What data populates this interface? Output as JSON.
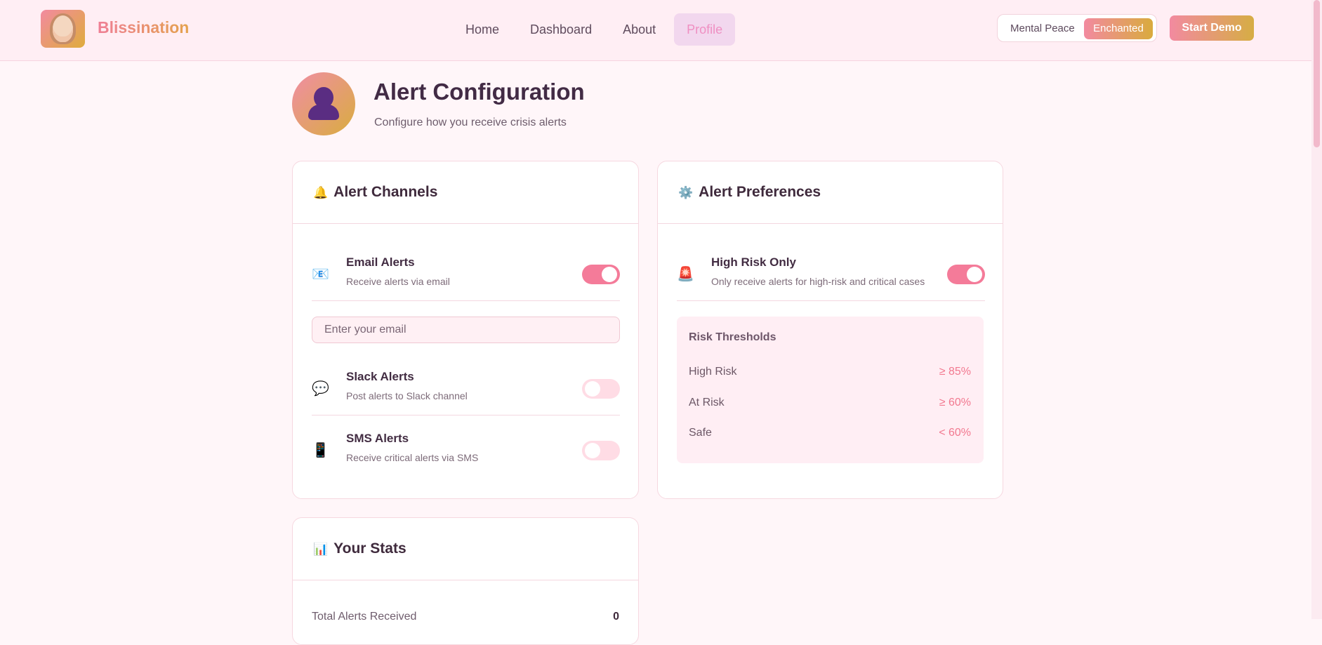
{
  "brand": {
    "name": "Blissination"
  },
  "nav": {
    "home": "Home",
    "dashboard": "Dashboard",
    "about": "About",
    "profile": "Profile"
  },
  "theme": {
    "left": "Mental Peace",
    "right": "Enchanted"
  },
  "actions": {
    "start_demo": "Start Demo"
  },
  "page": {
    "title": "Alert Configuration",
    "subtitle": "Configure how you receive crisis alerts"
  },
  "alert_channels": {
    "title": "Alert Channels",
    "email": {
      "title": "Email Alerts",
      "description": "Receive alerts via email",
      "enabled": true,
      "placeholder": "Enter your email"
    },
    "slack": {
      "title": "Slack Alerts",
      "description": "Post alerts to Slack channel",
      "enabled": false
    },
    "sms": {
      "title": "SMS Alerts",
      "description": "Receive critical alerts via SMS",
      "enabled": false
    }
  },
  "alert_preferences": {
    "title": "Alert Preferences",
    "high_risk": {
      "title": "High Risk Only",
      "description": "Only receive alerts for high-risk and critical cases",
      "enabled": true
    },
    "thresholds": {
      "title": "Risk Thresholds",
      "items": [
        {
          "label": "High Risk",
          "value": "≥ 85%"
        },
        {
          "label": "At Risk",
          "value": "≥ 60%"
        },
        {
          "label": "Safe",
          "value": "< 60%"
        }
      ]
    }
  },
  "stats": {
    "title": "Your Stats",
    "total_alerts_label": "Total Alerts Received",
    "total_alerts_value": "0"
  },
  "icons": {
    "bell": "🔔",
    "gear": "⚙️",
    "email": "📧",
    "chat": "💬",
    "phone": "📱",
    "siren": "🚨",
    "chart": "📊"
  }
}
